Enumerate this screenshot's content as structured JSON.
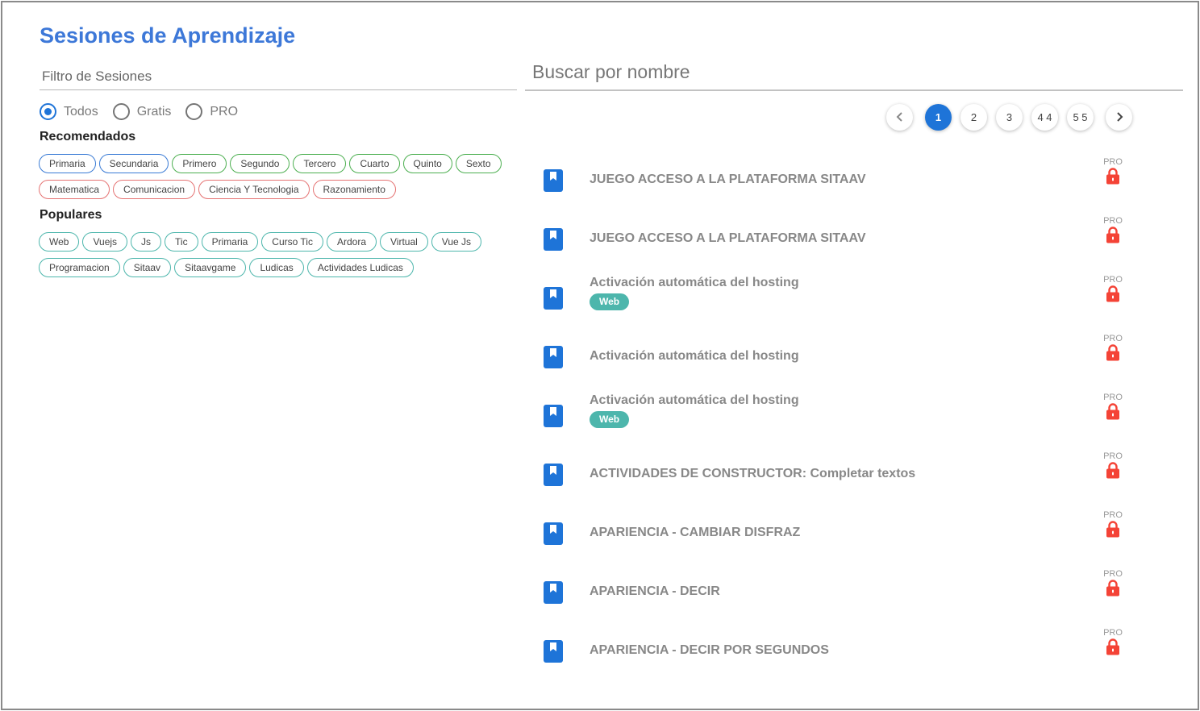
{
  "page": {
    "title": "Sesiones de Aprendizaje"
  },
  "filter": {
    "label": "Filtro de Sesiones"
  },
  "search": {
    "placeholder": "Buscar por nombre"
  },
  "radios": [
    {
      "label": "Todos",
      "checked": true
    },
    {
      "label": "Gratis",
      "checked": false
    },
    {
      "label": "PRO",
      "checked": false
    }
  ],
  "recomendados": {
    "heading": "Recomendados",
    "chips": [
      {
        "label": "Primaria",
        "color": "blue"
      },
      {
        "label": "Secundaria",
        "color": "blue"
      },
      {
        "label": "Primero",
        "color": "green"
      },
      {
        "label": "Segundo",
        "color": "green"
      },
      {
        "label": "Tercero",
        "color": "green"
      },
      {
        "label": "Cuarto",
        "color": "green"
      },
      {
        "label": "Quinto",
        "color": "green"
      },
      {
        "label": "Sexto",
        "color": "green"
      },
      {
        "label": "Matematica",
        "color": "red"
      },
      {
        "label": "Comunicacion",
        "color": "red"
      },
      {
        "label": "Ciencia Y Tecnologia",
        "color": "red"
      },
      {
        "label": "Razonamiento",
        "color": "red"
      }
    ]
  },
  "populares": {
    "heading": "Populares",
    "chips": [
      {
        "label": "Web"
      },
      {
        "label": "Vuejs"
      },
      {
        "label": "Js"
      },
      {
        "label": "Tic"
      },
      {
        "label": "Primaria"
      },
      {
        "label": "Curso Tic"
      },
      {
        "label": "Ardora"
      },
      {
        "label": "Virtual"
      },
      {
        "label": "Vue Js"
      },
      {
        "label": "Programacion"
      },
      {
        "label": "Sitaav"
      },
      {
        "label": "Sitaavgame"
      },
      {
        "label": "Ludicas"
      },
      {
        "label": "Actividades Ludicas"
      }
    ]
  },
  "pagination": {
    "pages": [
      "1",
      "2",
      "3",
      "4 4",
      "5 5"
    ],
    "active": "1",
    "prev_icon": "chevron-left-icon",
    "next_icon": "chevron-right-icon"
  },
  "colors": {
    "accent": "#1e74d8",
    "title": "#3d78d8",
    "tag": "#4db6ac",
    "lock": "#f44336"
  },
  "sessions": [
    {
      "title": "JUEGO ACCESO A LA PLATAFORMA SITAAV",
      "tag": null,
      "pro": "PRO"
    },
    {
      "title": "JUEGO ACCESO A LA PLATAFORMA SITAAV",
      "tag": null,
      "pro": "PRO"
    },
    {
      "title": "Activación automática del hosting",
      "tag": "Web",
      "pro": "PRO"
    },
    {
      "title": "Activación automática del hosting",
      "tag": null,
      "pro": "PRO"
    },
    {
      "title": "Activación automática del hosting",
      "tag": "Web",
      "pro": "PRO"
    },
    {
      "title": "ACTIVIDADES DE CONSTRUCTOR: Completar textos",
      "tag": null,
      "pro": "PRO"
    },
    {
      "title": "APARIENCIA - CAMBIAR DISFRAZ",
      "tag": null,
      "pro": "PRO"
    },
    {
      "title": "APARIENCIA - DECIR",
      "tag": null,
      "pro": "PRO"
    },
    {
      "title": "APARIENCIA - DECIR POR SEGUNDOS",
      "tag": null,
      "pro": "PRO"
    }
  ]
}
